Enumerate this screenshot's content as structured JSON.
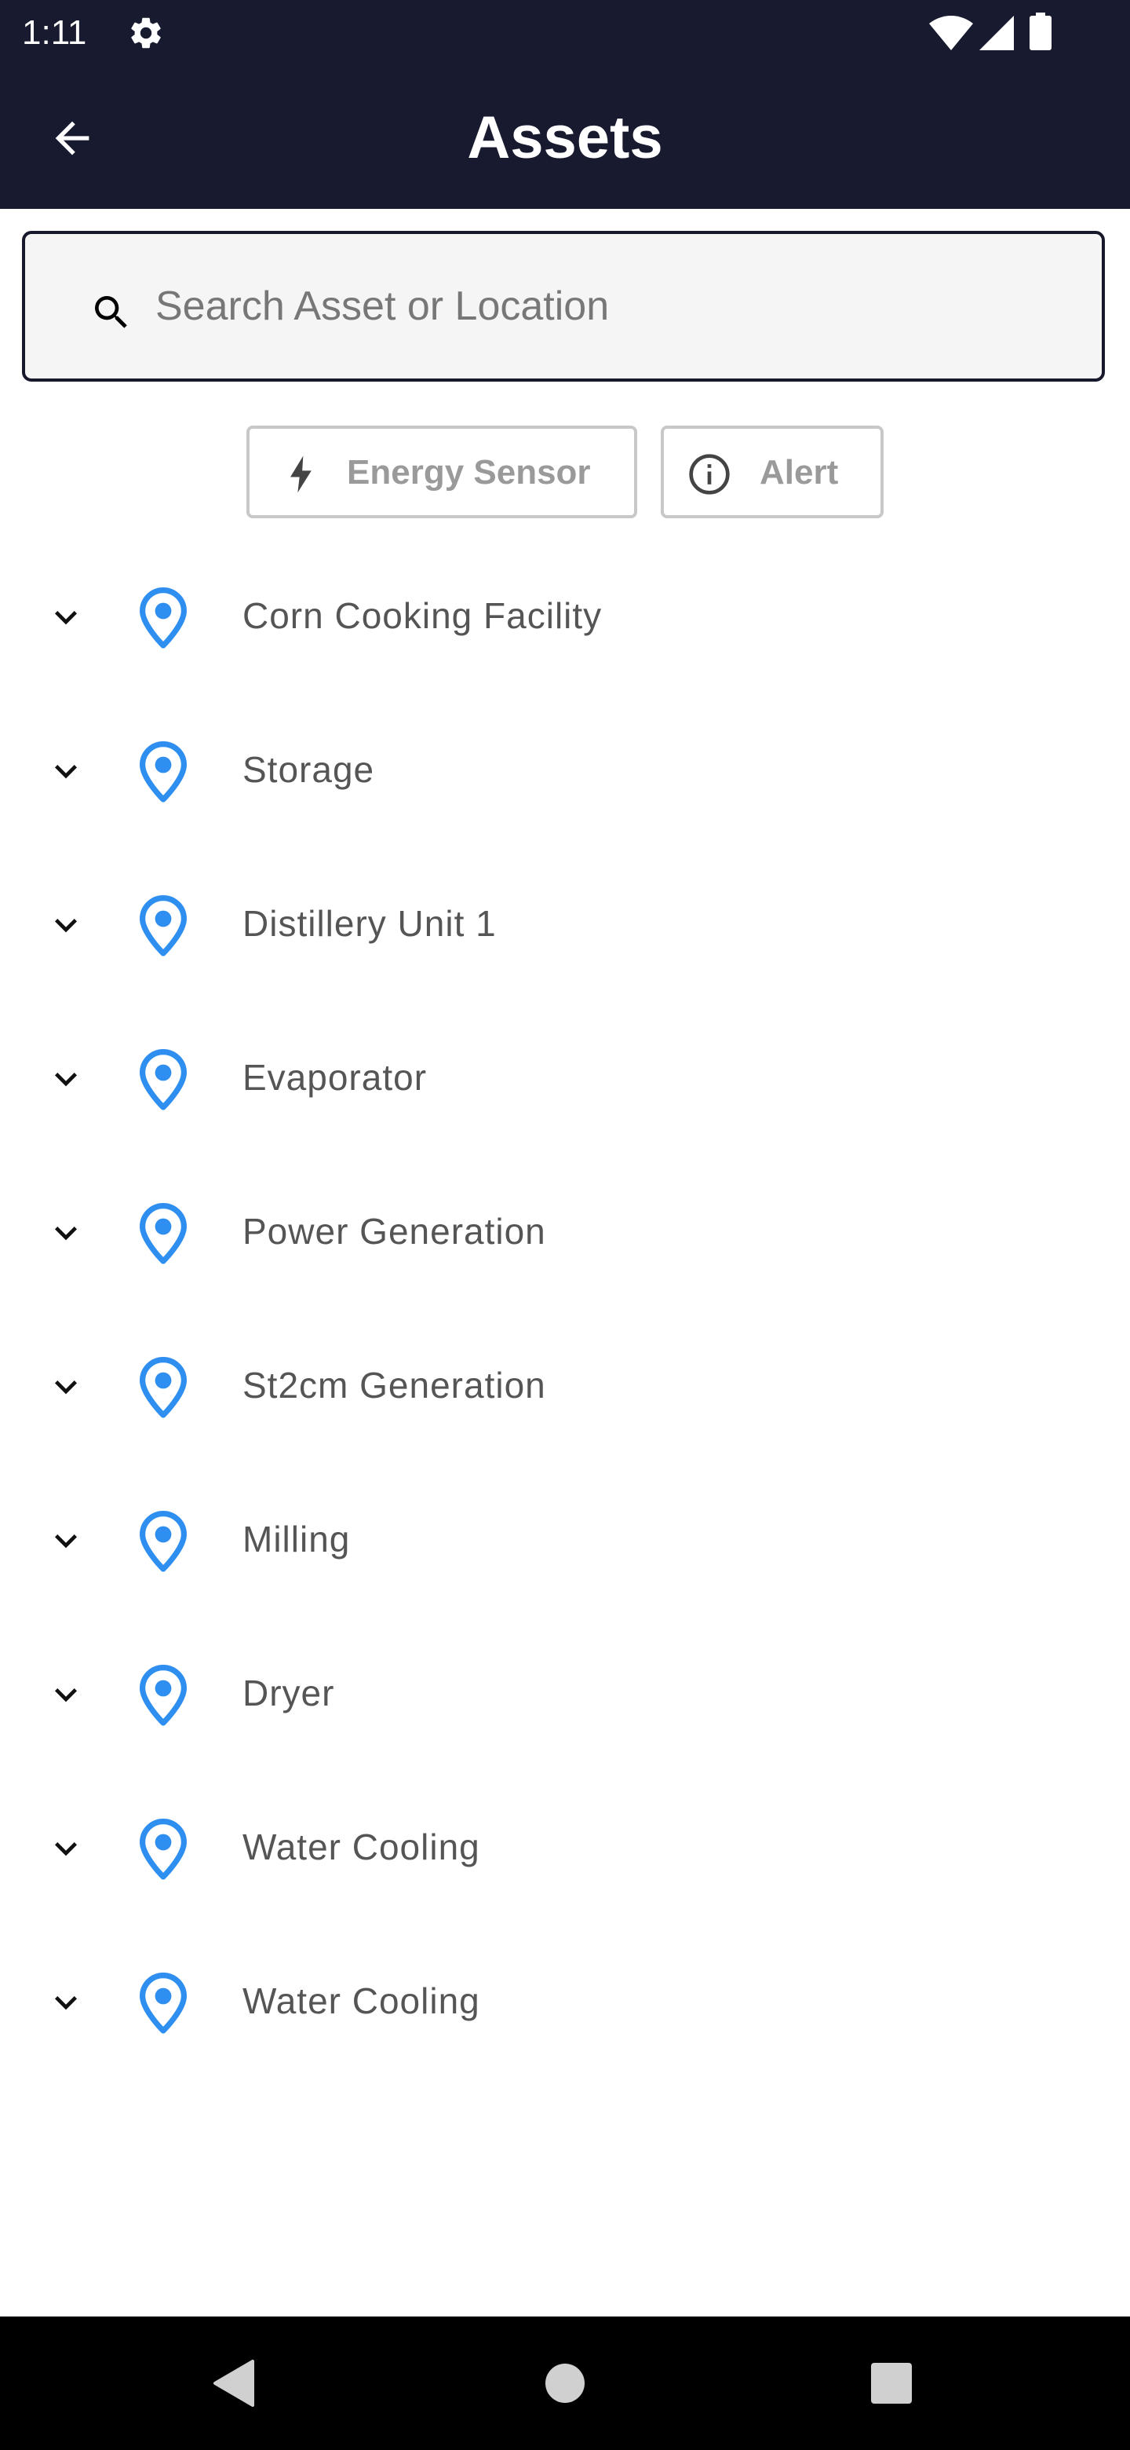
{
  "status_bar": {
    "time": "1:11",
    "left_icons": [
      "gear-icon"
    ],
    "right_icons": [
      "wifi-icon",
      "cell-signal-icon",
      "battery-icon"
    ]
  },
  "app_bar": {
    "title": "Assets",
    "back_icon": "arrow-left-icon",
    "background_color": "#181b2f"
  },
  "search": {
    "placeholder": "Search Asset or Location",
    "value": "",
    "icon": "search-icon"
  },
  "filters": [
    {
      "label": "Energy Sensor",
      "icon": "bolt-icon"
    },
    {
      "label": "Alert",
      "icon": "info-circle-icon"
    }
  ],
  "assets": [
    {
      "label": "Corn Cooking Facility",
      "icon": "location-pin-icon"
    },
    {
      "label": "Storage",
      "icon": "location-pin-icon"
    },
    {
      "label": "Distillery Unit 1",
      "icon": "location-pin-icon"
    },
    {
      "label": "Evaporator",
      "icon": "location-pin-icon"
    },
    {
      "label": "Power Generation",
      "icon": "location-pin-icon"
    },
    {
      "label": "St2cm Generation",
      "icon": "location-pin-icon"
    },
    {
      "label": "Milling",
      "icon": "location-pin-icon"
    },
    {
      "label": "Dryer",
      "icon": "location-pin-icon"
    },
    {
      "label": "Water Cooling",
      "icon": "location-pin-icon"
    },
    {
      "label": "Water Cooling",
      "icon": "location-pin-icon"
    }
  ],
  "colors": {
    "pin_blue": "#2f8ff0",
    "chip_text": "#9a9a9a",
    "row_text": "#555555"
  },
  "nav_bar": {
    "buttons": [
      "back-triangle-icon",
      "home-circle-icon",
      "recents-square-icon"
    ]
  }
}
